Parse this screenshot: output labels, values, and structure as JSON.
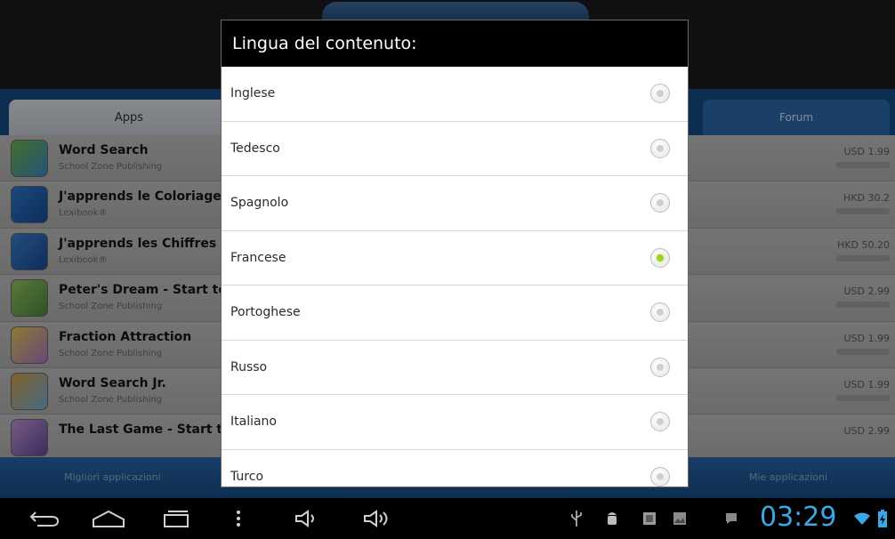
{
  "background_app": {
    "tabs": {
      "apps": "Apps",
      "forum": "Forum"
    },
    "apps": [
      {
        "name": "Word Search",
        "publisher": "School Zone Publishing",
        "price": "USD 1.99"
      },
      {
        "name": "J'apprends le Coloriage",
        "publisher": "Lexibook®",
        "price": "HKD 30.2"
      },
      {
        "name": "J'apprends les Chiffres",
        "publisher": "Lexibook®",
        "price": "HKD 50.20"
      },
      {
        "name": "Peter's Dream - Start to Re",
        "publisher": "School Zone Publishing",
        "price": "USD 2.99"
      },
      {
        "name": "Fraction Attraction",
        "publisher": "School Zone Publishing",
        "price": "USD 1.99"
      },
      {
        "name": "Word Search Jr.",
        "publisher": "School Zone Publishing",
        "price": "USD 1.99"
      },
      {
        "name": "The Last Game - Start to Re",
        "publisher": "",
        "price": "USD 2.99"
      }
    ],
    "bottom_left": "Migliori applicazioni",
    "bottom_right": "Mie applicazioni"
  },
  "dialog": {
    "title": "Lingua del contenuto:",
    "options": [
      {
        "label": "Inglese",
        "selected": false
      },
      {
        "label": "Tedesco",
        "selected": false
      },
      {
        "label": "Spagnolo",
        "selected": false
      },
      {
        "label": "Francese",
        "selected": true
      },
      {
        "label": "Portoghese",
        "selected": false
      },
      {
        "label": "Russo",
        "selected": false
      },
      {
        "label": "Italiano",
        "selected": false
      },
      {
        "label": "Turco",
        "selected": false
      }
    ]
  },
  "status_bar": {
    "time": "03:29",
    "icons": [
      "back-icon",
      "home-icon",
      "recent-apps-icon",
      "menu-icon",
      "volume-down-icon",
      "volume-up-icon",
      "usb-icon",
      "android-debug-icon",
      "screenshot-icon",
      "gallery-icon",
      "notification-icon",
      "wifi-icon",
      "battery-icon"
    ]
  },
  "colors": {
    "accent_blue": "#1d5799",
    "radio_selected": "#9bd12a",
    "clock_blue": "#3aa7e6"
  }
}
